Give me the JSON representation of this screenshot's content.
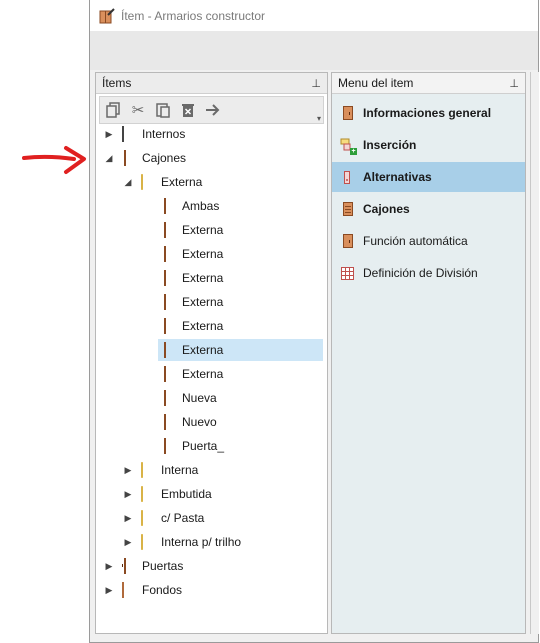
{
  "window": {
    "title": "Ítem - Armarios constructor"
  },
  "left_pane": {
    "header": "Ítems",
    "pin_icon": "pin-icon",
    "toolbar_icons": [
      "copy-icon",
      "cut-icon",
      "paste-icon",
      "delete-icon",
      "arrow-right-icon"
    ]
  },
  "tree": {
    "items": [
      {
        "label": "Internos",
        "icon": "internal-icon",
        "expander": "collapsed"
      },
      {
        "label": "Cajones",
        "icon": "drawer-icon",
        "expander": "expanded"
      },
      {
        "label": "Externa",
        "icon": "folder-icon",
        "expander": "expanded"
      },
      {
        "label": "Ambas",
        "icon": "drawer-icon"
      },
      {
        "label": "Externa",
        "icon": "drawer-icon"
      },
      {
        "label": "Externa",
        "icon": "drawer-icon"
      },
      {
        "label": "Externa",
        "icon": "drawer-icon"
      },
      {
        "label": "Externa",
        "icon": "drawer-icon"
      },
      {
        "label": "Externa",
        "icon": "drawer-icon"
      },
      {
        "label": "Externa",
        "icon": "drawer-icon",
        "selected": true
      },
      {
        "label": "Externa",
        "icon": "drawer-icon"
      },
      {
        "label": "Nueva",
        "icon": "drawer-icon"
      },
      {
        "label": "Nuevo",
        "icon": "drawer-icon"
      },
      {
        "label": "Puerta_",
        "icon": "drawer-icon"
      },
      {
        "label": "Interna",
        "icon": "folder-icon",
        "expander": "collapsed"
      },
      {
        "label": "Embutida",
        "icon": "folder-icon",
        "expander": "collapsed"
      },
      {
        "label": "c/ Pasta",
        "icon": "folder-icon",
        "expander": "collapsed"
      },
      {
        "label": "Interna p/ trilho",
        "icon": "folder-icon",
        "expander": "collapsed"
      },
      {
        "label": "Puertas",
        "icon": "door-icon",
        "expander": "collapsed"
      },
      {
        "label": "Fondos",
        "icon": "back-panel-icon",
        "expander": "collapsed"
      }
    ]
  },
  "right_pane": {
    "header": "Menu del item",
    "items": [
      {
        "label": "Informaciones general",
        "icon": "cabinet-info-icon",
        "bold": true
      },
      {
        "label": "Inserción",
        "icon": "insert-icon",
        "bold": true
      },
      {
        "label": "Alternativas",
        "icon": "alternatives-icon",
        "bold": true,
        "active": true
      },
      {
        "label": "Cajones",
        "icon": "drawer-icon",
        "bold": true
      },
      {
        "label": "Función automática",
        "icon": "auto-function-icon",
        "bold": false
      },
      {
        "label": "Definición de División",
        "icon": "division-grid-icon",
        "bold": false
      }
    ]
  },
  "colors": {
    "selection": "#cde6f7",
    "active_menu": "#a8cfe8",
    "annotation_arrow": "#e02020"
  }
}
